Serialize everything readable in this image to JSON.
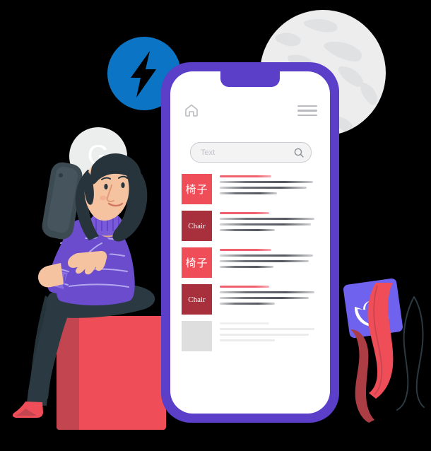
{
  "illustration": {
    "title": "Mobile search app illustration",
    "palette": {
      "phone_frame": "#5b3fc9",
      "screen": "#ffffff",
      "accent_red": "#ef4d58",
      "accent_dark_red": "#a8303c",
      "amp_blue": "#0b74c4",
      "globe_gray": "#ededee",
      "sweater_purple": "#6a4ccc",
      "pants_navy": "#2b3a42",
      "skin": "#f6c3a0",
      "hair": "#28343c",
      "chrome_tile": "#6f62ee"
    }
  },
  "phone": {
    "header": {
      "home_icon": "home-icon",
      "menu_icon": "hamburger-menu-icon"
    },
    "search": {
      "placeholder": "Text",
      "value": "",
      "icon": "search-magnifier-icon"
    },
    "list": {
      "items": [
        {
          "thumb_label": "椅子",
          "thumb_script": "cjk",
          "thumb_color": "#ef4d58",
          "line_widths": [
            "52%",
            "94%",
            "88%",
            "58%"
          ],
          "faded": false
        },
        {
          "thumb_label": "Chair",
          "thumb_script": "latin",
          "thumb_color": "#a8303c",
          "line_widths": [
            "50%",
            "96%",
            "92%",
            "56%"
          ],
          "faded": false
        },
        {
          "thumb_label": "椅子",
          "thumb_script": "cjk",
          "thumb_color": "#ef4d58",
          "line_widths": [
            "52%",
            "94%",
            "90%",
            "54%"
          ],
          "faded": false
        },
        {
          "thumb_label": "Chair",
          "thumb_script": "latin",
          "thumb_color": "#a8303c",
          "line_widths": [
            "50%",
            "96%",
            "90%",
            "56%"
          ],
          "faded": false
        },
        {
          "thumb_label": "",
          "thumb_script": "latin",
          "thumb_color": "#dedede",
          "line_widths": [
            "50%",
            "96%",
            "90%",
            "56%"
          ],
          "faded": true
        }
      ]
    }
  },
  "badges": {
    "amp": {
      "name": "amp-lightning-badge",
      "label": ""
    },
    "google": {
      "name": "google-g-badge",
      "label": "G"
    },
    "chrome": {
      "name": "chrome-logo-tile",
      "label": ""
    },
    "globe": {
      "name": "globe-world-map",
      "label": ""
    }
  },
  "character": {
    "name": "woman-with-phone",
    "held_device": "smartphone",
    "seat": "red-block"
  }
}
